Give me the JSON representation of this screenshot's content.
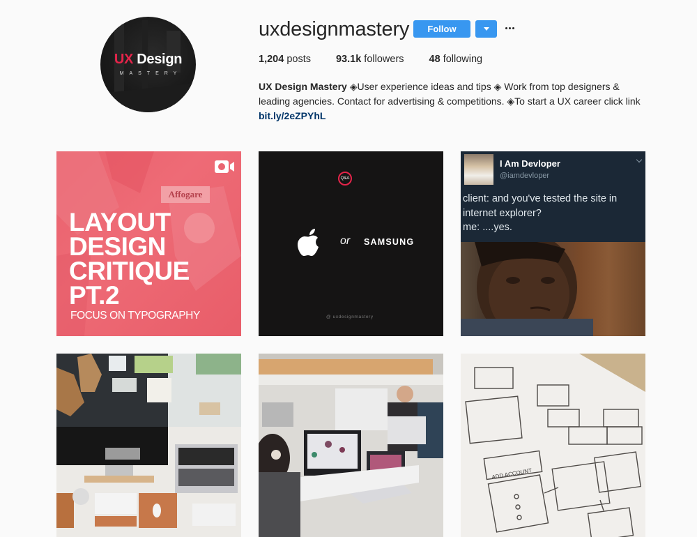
{
  "profile": {
    "avatar": {
      "line1_accent": "UX",
      "line1_rest": " Design",
      "line2": "MASTERY",
      "accent_color": "#e5244a"
    },
    "username": "uxdesignmastery",
    "follow_label": "Follow",
    "dropdown_icon": "caret-down-icon",
    "more_icon": "ellipsis-icon",
    "button_color": "#3897f0",
    "stats": {
      "posts_count": "1,204",
      "posts_label": " posts",
      "followers_count": "93.1k",
      "followers_label": " followers",
      "following_count": "48",
      "following_label": " following"
    },
    "bio": {
      "name": "UX Design Mastery",
      "text": " ◈User experience ideas and tips ◈ Work from top designers & leading agencies. Contact for advertising & competitions. ◈To start a UX career click link ",
      "link": "bit.ly/2eZPYhL"
    }
  },
  "posts": [
    {
      "id": "layout-critique",
      "title_lines": [
        "LAYOUT",
        "DESIGN",
        "CRITIQUE",
        "PT.2"
      ],
      "subtitle": "FOCUS ON TYPOGRAPHY",
      "background_sign": "Affogare",
      "type_icon": "video-icon"
    },
    {
      "id": "apple-or-samsung",
      "badge": "Q&A",
      "or_text": "or",
      "brand_right": "SAMSUNG",
      "brand_left_icon": "apple-logo-icon",
      "handle": "@ uxdesignmastery"
    },
    {
      "id": "devloper-meme",
      "tweet_name": "I Am Devloper",
      "tweet_handle": "@iamdevloper",
      "tweet_lines": [
        "client: and you've tested the site in",
        "internet explorer?",
        "me: ....yes."
      ]
    },
    {
      "id": "desk-setup",
      "description": "desk with iMac, laptop and keyboards"
    },
    {
      "id": "office-workspace",
      "description": "open office with designers at monitors"
    },
    {
      "id": "wireframe-sketches",
      "description": "hand-drawn wireframe sketches",
      "sketch_label": "ADD ACCOUNT"
    }
  ]
}
